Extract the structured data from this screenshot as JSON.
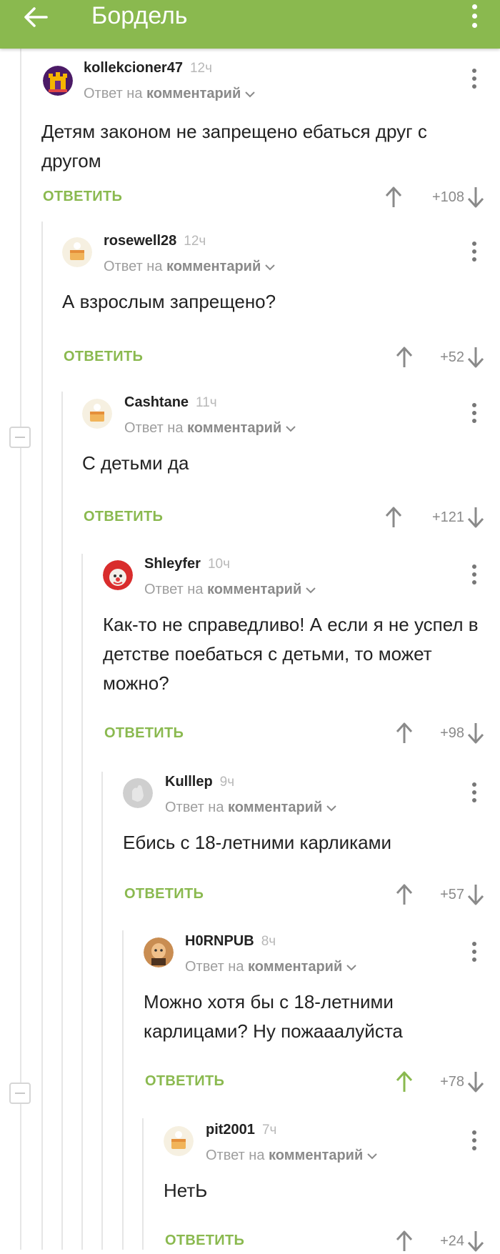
{
  "header": {
    "title": "Бордель",
    "back_icon": "arrow-left-icon",
    "menu_icon": "more-vertical-icon",
    "color": "#8ab94f"
  },
  "labels": {
    "reply_prefix": "Ответ на",
    "reply_target": "комментарий",
    "reply_button": "ОТВЕТИТЬ"
  },
  "comments": [
    {
      "username": "kollekcioner47",
      "time": "12ч",
      "text": "Детям законом не запрещено ебаться друг с другом",
      "score": "+108",
      "avatar": "tower-avatar"
    },
    {
      "username": "rosewell28",
      "time": "12ч",
      "text": "А взрослым запрещено?",
      "score": "+52",
      "avatar": "cake-avatar"
    },
    {
      "username": "Cashtane",
      "time": "11ч",
      "text": "С детьми да",
      "score": "+121",
      "avatar": "cake-avatar"
    },
    {
      "username": "Shleyfer",
      "time": "10ч",
      "text": "Как-то не справедливо! А если я не успел в детстве поебаться с детьми, то может можно?",
      "score": "+98",
      "avatar": "clown-avatar"
    },
    {
      "username": "Kulllep",
      "time": "9ч",
      "text": "Ебись с 18-летними карликами",
      "score": "+57",
      "avatar": "grey-hand-avatar"
    },
    {
      "username": "H0RNPUB",
      "time": "8ч",
      "text": "Можно хотя бы с 18-летними карлицами? Ну пожааалуйста",
      "score": "+78",
      "avatar": "bald-man-avatar",
      "upvoted": true
    },
    {
      "username": "pit2001",
      "time": "7ч",
      "text": "НетЬ",
      "score": "+24",
      "avatar": "cake-avatar"
    }
  ]
}
